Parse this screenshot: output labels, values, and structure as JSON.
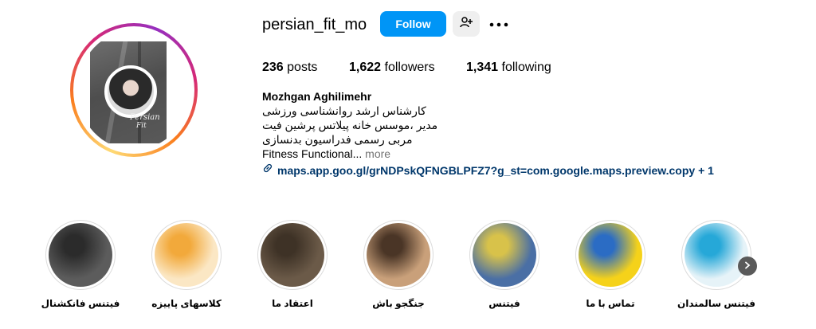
{
  "profile": {
    "username": "persian_fit_mo",
    "follow_label": "Follow",
    "avatar_text_1": "Persian",
    "avatar_text_2": "Fit",
    "avatar_text_3": "Mozhgan Aghilimehr"
  },
  "stats": {
    "posts_count": "236",
    "posts_label": "posts",
    "followers_count": "1,622",
    "followers_label": "followers",
    "following_count": "1,341",
    "following_label": "following"
  },
  "bio": {
    "name": "Mozhgan Aghilimehr",
    "line1": "کارشناس ارشد روانشناسی ورزشی",
    "line2": "مدیر ،موسس خانه پیلاتس پرشین فیت",
    "line3": "مربی رسمی فدراسیون بدنسازی",
    "line4": "Fitness Functional...",
    "more": "more",
    "link": "maps.app.goo.gl/grNDPskQFNGBLPFZ7?g_st=com.google.maps.preview.copy + 1"
  },
  "highlights": [
    {
      "label": "فیتنس فانکشنال",
      "bg": "#5c5c5c",
      "accent": "#2b2b2b"
    },
    {
      "label": "کلاسهای پاییزه",
      "bg": "#fbe7c4",
      "accent": "#f2a93b"
    },
    {
      "label": "اعتقاد ما",
      "bg": "#6b5a48",
      "accent": "#3e3226"
    },
    {
      "label": "جنگجو باش",
      "bg": "#c9a07a",
      "accent": "#4a3526"
    },
    {
      "label": "فیتنس",
      "bg": "#4a6fa5",
      "accent": "#d8c24a"
    },
    {
      "label": "تماس با ما",
      "bg": "#f5d21a",
      "accent": "#2b6cc4"
    },
    {
      "label": "فیتنس سالمندان",
      "bg": "#e6f3f8",
      "accent": "#26a8d8"
    }
  ],
  "colors": {
    "follow_bg": "#0095f6",
    "link": "#00376b",
    "muted": "#737373"
  },
  "icons": {
    "suggest": "add-person-icon",
    "more": "more-dots-icon",
    "link": "link-icon",
    "next": "chevron-right-icon"
  }
}
